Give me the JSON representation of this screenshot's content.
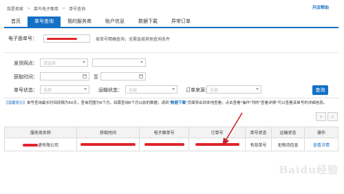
{
  "breadcrumb": {
    "home": "我是卖家",
    "sep": ">",
    "level1": "菜鸟电子面单",
    "level2": "单号查询"
  },
  "help_label": "开店帮助",
  "tabs": [
    "首页",
    "单号查询",
    "我的服务商",
    "账户信息",
    "数据下载",
    "异常订单"
  ],
  "waybill": {
    "label": "电子面单号：",
    "hint": "按单号精确查询，无需选择其他查询条件"
  },
  "filters": {
    "branch_label": "发货网点：",
    "branch_placeholder": "请选择",
    "time_label": "获取时间：",
    "time_to": "至",
    "status_label": "单号状态：",
    "status_value": "全部",
    "transport_label": "运输状态：",
    "transport_value": "全部",
    "source_label": "订单来源：",
    "source_value": "全部"
  },
  "search_button": "查询",
  "notice": {
    "tag": "【温馨提示】",
    "text1": "单号查询最长时间间隔为60天，查询范围为6个月，如需查询6个月以前的数据，请到",
    "link": "数据下载",
    "text2": "页面导出到本地查看；点击查看\"操作\"列的\"查看详情\"可以查看该单号的详细信息。"
  },
  "pager": {
    "prev": "‹",
    "next": "›"
  },
  "table": {
    "headers": [
      "服务商名称",
      "获取时间",
      "电子面单号",
      "订单号",
      "单号状态",
      "运输状态",
      "操作"
    ],
    "row": {
      "provider_suffix": "递有限公司",
      "status": "有效单号",
      "transport": "无物流信息",
      "action": "查看详情"
    }
  },
  "watermark": "Baidu经验",
  "colors": {
    "accent": "#1470c4",
    "redaction": "#e0262d",
    "arrow": "#c8232b"
  }
}
